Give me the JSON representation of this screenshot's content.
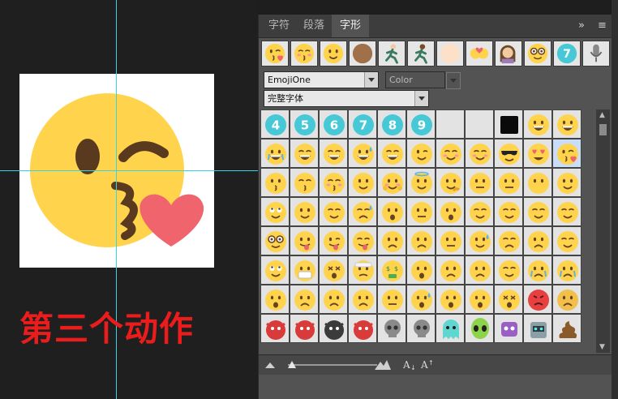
{
  "caption": "第三个动作",
  "panel": {
    "tabs": [
      {
        "label": "字符",
        "active": false
      },
      {
        "label": "段落",
        "active": false
      },
      {
        "label": "字形",
        "active": true
      }
    ],
    "collapse_label": "»",
    "menu_label": "≡"
  },
  "font_family": "EmojiOne",
  "font_style": "Color",
  "subset": "完整字体",
  "recent_glyphs": [
    "kissing-heart",
    "kissing-blush",
    "slight-smile",
    "brown-circle",
    "runner-light",
    "runner-dark",
    "skin-light-circle",
    "couple-heart",
    "woman-tipping-hand",
    "nerd-face",
    "keycap-7",
    "microphone"
  ],
  "grid_rows": [
    [
      "keycap-4",
      "keycap-5",
      "keycap-6",
      "keycap-7",
      "keycap-8",
      "keycap-9",
      "blank",
      "blank",
      "black-square",
      "grin",
      "grin-big"
    ],
    [
      "joy",
      "smile-big",
      "laugh",
      "sweat-smile",
      "laughing",
      "wink",
      "blush",
      "yum",
      "sunglasses",
      "heart-eyes",
      "kissing-heart"
    ],
    [
      "kissing",
      "kissing-smile",
      "kissing-blush",
      "slight-smile",
      "hugging",
      "innocent",
      "thinking",
      "neutral",
      "expressionless",
      "no-mouth",
      "blank-face"
    ],
    [
      "rolling-eyes",
      "smirk",
      "persevere",
      "disappointed-relieved",
      "open-mouth",
      "zipper",
      "hushed",
      "tired",
      "sleepy",
      "sleeping",
      "relieved"
    ],
    [
      "nerd-face",
      "tongue",
      "tongue-wink",
      "tongue-closed",
      "frown",
      "confused",
      "unamused",
      "sweat",
      "pensive",
      "worried",
      "confounded"
    ],
    [
      "upside-down",
      "mask",
      "dizzy-face",
      "bandage",
      "money-mouth",
      "astonished",
      "slight-frown",
      "worried-2",
      "triumph",
      "cry",
      "sob"
    ],
    [
      "frowning-open",
      "anguished",
      "fearful",
      "weary",
      "grimace",
      "cold-sweat",
      "scream",
      "flushed",
      "dizzy",
      "rage",
      "angry"
    ],
    [
      "smiling-imp",
      "ogre",
      "goblin",
      "devil-red",
      "skull",
      "skull-bones",
      "ghost",
      "alien",
      "alien-monster",
      "robot",
      "poop"
    ]
  ],
  "selected_glyph": "kissing-heart",
  "colors": {
    "accent_guide": "#32d7e6",
    "caption_red": "#ea1c1c",
    "panel_bg": "#535353",
    "cell_bg": "#e3e3e3",
    "emoji_yellow": "#ffd44c",
    "heart": "#f0646e"
  }
}
